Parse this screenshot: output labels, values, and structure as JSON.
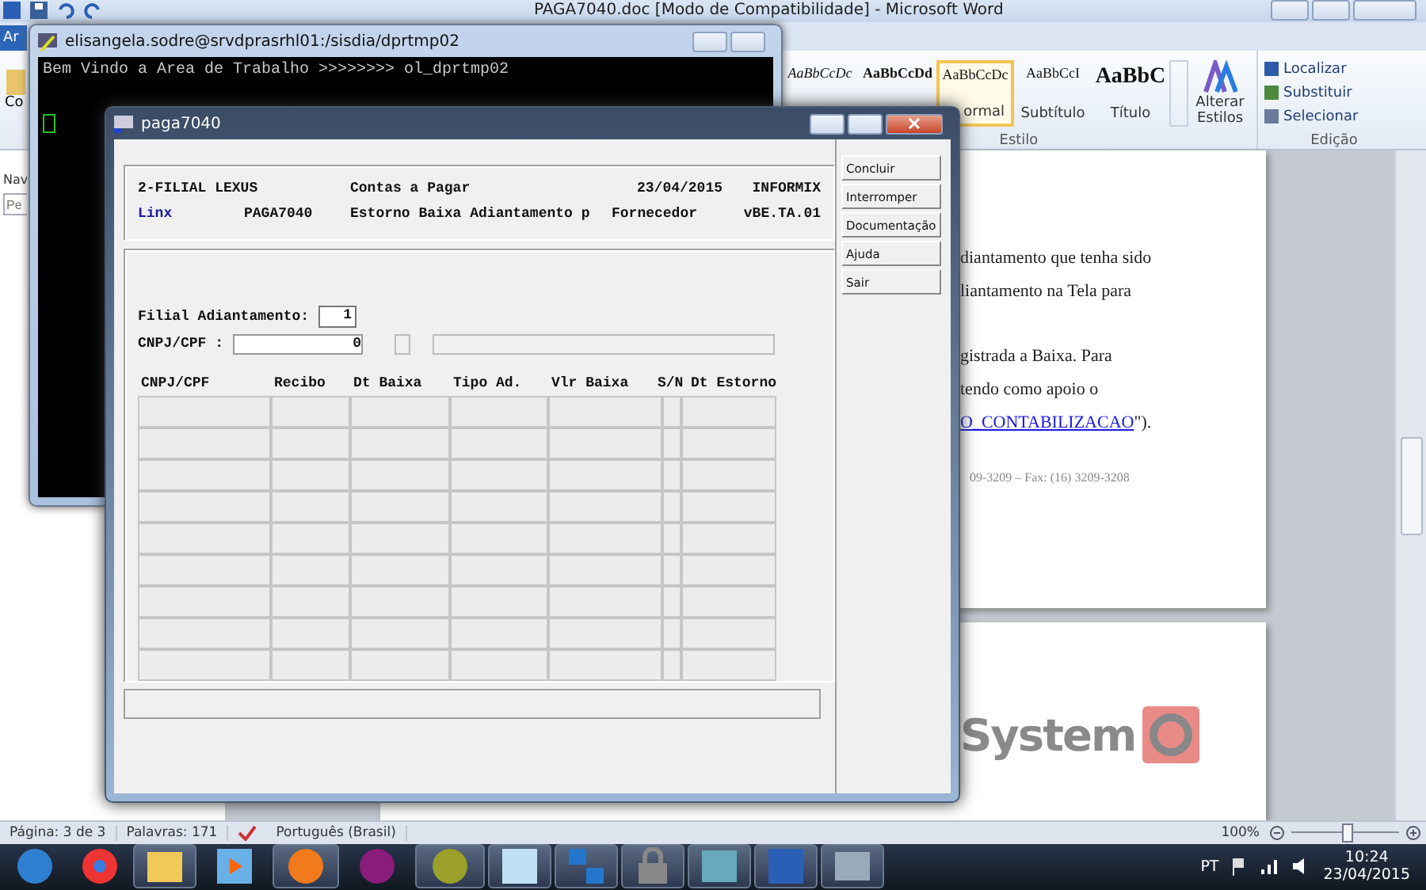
{
  "word": {
    "title": "PAGA7040.doc [Modo de Compatibilidade]  -  Microsoft Word",
    "file_tab": "Ar",
    "paste_label": "Co",
    "styles": [
      {
        "preview": "AaBbCcDc",
        "kind": "italic",
        "selected": false
      },
      {
        "preview": "AaBbCcDd",
        "kind": "bold",
        "selected": false
      },
      {
        "preview": "AaBbCcDc",
        "label": "ormal",
        "kind": "plain",
        "selected": true
      },
      {
        "preview": "AaBbCcI",
        "label": "Subtítulo",
        "kind": "plain",
        "selected": false
      },
      {
        "preview": "AaBbC",
        "label": "Título",
        "kind": "large",
        "selected": false
      }
    ],
    "change_styles": "Alterar Estilos",
    "style_group": "Estilo",
    "edit_items": [
      "Localizar",
      "Substituir",
      "Selecionar"
    ],
    "edit_group": "Edição",
    "nav_title": "Nav",
    "nav_search": {
      "placeholder": "Pe"
    }
  },
  "document": {
    "lines": [
      "diantamento que tenha sido",
      "liantamento na Tela  para",
      "gistrada a Baixa.  Para",
      "tendo como apoio o"
    ],
    "link": "O_CONTABILIZACAO",
    "after_link": "\").",
    "footer": "09-3209 – Fax: (16) 3209-3208",
    "logo": "System"
  },
  "status_bar": {
    "page": "Página: 3 de 3",
    "words": "Palavras: 171",
    "language": "Português (Brasil)",
    "zoom": "100%",
    "zoom_slider": {
      "level": 0.5
    }
  },
  "terminal": {
    "title": "elisangela.sodre@srvdprasrhl01:/sisdia/dprtmp02",
    "lines": [
      "Bem Vindo a Area de Trabalho >>>>>>>>  ol_dprtmp02"
    ]
  },
  "app": {
    "title": "paga7040",
    "header": {
      "company": "2-FILIAL LEXUS",
      "module": "Contas a Pagar",
      "date": "23/04/2015",
      "database": "INFORMIX",
      "brand": "Linx",
      "program": "PAGA7040",
      "description": "Estorno Baixa Adiantamento p",
      "party": "Fornecedor",
      "version": "vBE.TA.01"
    },
    "fields": [
      {
        "label": "Filial Adiantamento:",
        "value": "1"
      },
      {
        "label": "CNPJ/CPF :",
        "value": "0"
      }
    ],
    "table": {
      "columns": [
        "CNPJ/CPF",
        "Recibo",
        "Dt Baixa",
        "Tipo Ad.",
        "Vlr Baixa",
        "S/N",
        "Dt Estorno"
      ]
    },
    "buttons": [
      "Concluir",
      "Interromper",
      "Documentação",
      "Ajuda",
      "Sair"
    ]
  },
  "taskbar": {
    "buttons": [
      {
        "open": false
      },
      {
        "open": true
      },
      {
        "open": false
      },
      {
        "open": true
      },
      {
        "open": false
      },
      {
        "open": true
      },
      {
        "open": true
      },
      {
        "open": true
      },
      {
        "open": true
      },
      {
        "open": true
      },
      {
        "open": true
      },
      {
        "open": true
      }
    ],
    "language": "PT",
    "time": "10:24",
    "date": "23/04/2015"
  }
}
